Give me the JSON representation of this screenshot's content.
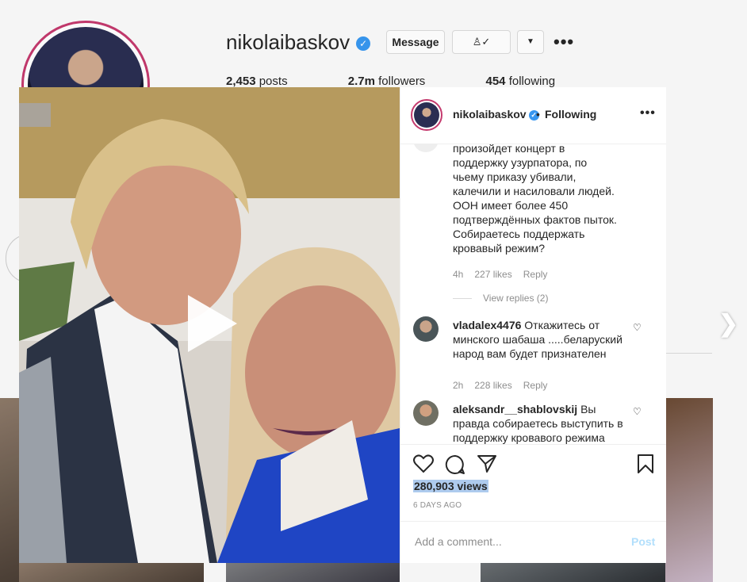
{
  "profile": {
    "username": "nikolaibaskov",
    "message_label": "Message",
    "follow_icon": "person-check-icon",
    "posts": "2,453",
    "posts_label": "posts",
    "followers": "2.7m",
    "followers_label": "followers",
    "following": "454",
    "following_label": "following"
  },
  "post": {
    "author": "nikolaibaskov",
    "separator": "•",
    "follow_status": "Following",
    "comments": [
      {
        "text_lines": [
          "произойдет концерт в",
          "поддержку узурпатора, по",
          "чьему приказу убивали,",
          "калечили и насиловали людей.",
          "ООН имеет более 450",
          "подтверждённых фактов пыток.",
          "Собираетесь поддержать",
          "кровавый режим?"
        ],
        "time": "4h",
        "likes": "227 likes",
        "reply": "Reply",
        "view_replies": "View replies (2)"
      },
      {
        "user": "vladalex4476",
        "text_first": " Откажитесь от",
        "text_lines": [
          "минского шабаша .....беларуский",
          "народ вам будет признателен"
        ],
        "time": "2h",
        "likes": "228 likes",
        "reply": "Reply"
      },
      {
        "user": "aleksandr__shablovskij",
        "text_first": " Вы",
        "text_lines": [
          "правда собираетесь выступить в",
          "поддержку кровавого режима"
        ]
      }
    ],
    "views": "280,903 views",
    "date": "6 DAYS AGO",
    "comment_placeholder": "Add a comment...",
    "post_label": "Post"
  },
  "colors": {
    "accent": "#3897f0",
    "highlight": "#aecbee",
    "post_disabled": "#b2dffc"
  }
}
